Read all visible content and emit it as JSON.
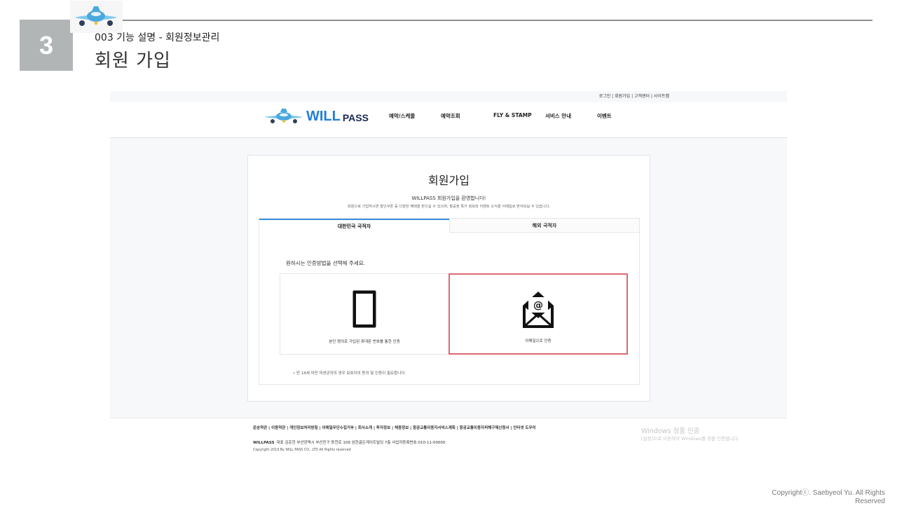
{
  "slide": {
    "number": "3",
    "subtitle": "003 기능 설명 - 회원정보관리",
    "title": "회원 가입",
    "copyright": "Copyrightⓒ. Saebyeol Yu. All Rights Reserved"
  },
  "site": {
    "util_links": "로그인 | 회원가입 | 고객센터 | 사이트맵",
    "brand_will": "WILL",
    "brand_pass": "PASS",
    "nav": [
      "예약/스케줄",
      "예약조회",
      "FLY & STAMP",
      "서비스 안내",
      "이벤트"
    ]
  },
  "signup": {
    "title": "회원가입",
    "welcome": "WILLPASS 회원가입을 환영합니다!",
    "description": "회원으로 가입하시면 할인쿠폰 등 다양한 혜택을 받으실 수 있으며, 항공권 특가 정보와 이벤트 소식을 이메일로 받아보실 수 있습니다.",
    "tabs": [
      "대한민국 국적자",
      "해외 국적자"
    ],
    "prompt": "원하시는 인증방법을 선택해 주세요.",
    "options": [
      {
        "label": "본인 명의로 가입된 휴대폰 번호를 통한 인증",
        "icon": "smartphone-icon"
      },
      {
        "label": "이메일으로 인증",
        "icon": "email-envelope-icon"
      }
    ],
    "note": "•   만 14세 미만 미성년자의 경우 보호자의 동의 및 인증이 필요합니다."
  },
  "footer": {
    "links": "운송약관 | 이용약관 | 개인정보처리방침 | 이메일무단수집거부 | 회사소개 | 투자정보 | 채용정보 | 항공교통이용자서비스계획 | 항공교통이용자피해구제신청서 | 인터넷 도우미",
    "company_name": "WILLPASS",
    "company_info": "대표 김준한 부산광역시 부산진구 동천로 109 삼한골든게이트빌딩 7층 사업자등록번호:010-11-00000",
    "copyright": "Copyright 2019 By WILL PASS CO., LTD All Rights reserved"
  },
  "windows_notice": {
    "title": "Windows 정품 인증",
    "subtitle": "[설정]으로 이동하여 Windows를 정품 인증합니다."
  },
  "colors": {
    "accent_blue": "#1f7fd6",
    "highlight_red": "#dc6873",
    "number_box_gray": "#b2b5b6"
  }
}
